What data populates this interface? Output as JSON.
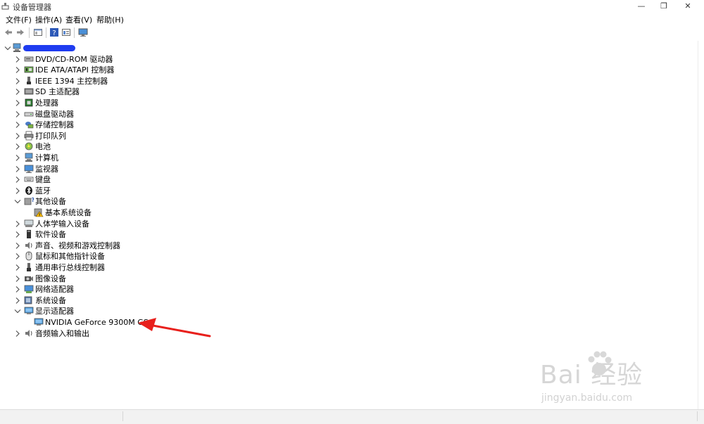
{
  "window": {
    "title": "设备管理器",
    "minimize_glyph": "—",
    "restore_glyph": "❐",
    "close_glyph": "✕"
  },
  "menu": [
    "文件(F)",
    "操作(A)",
    "查看(V)",
    "帮助(H)"
  ],
  "toolbar": [
    "back-icon",
    "forward-icon",
    "properties-icon",
    "help-icon",
    "details-icon",
    "monitor-icon"
  ],
  "tree": {
    "root": {
      "label": "",
      "icon": "computer-icon",
      "expanded": true
    },
    "items": [
      {
        "label": "DVD/CD-ROM 驱动器",
        "icon": "dvd-drive-icon",
        "expanded": false,
        "children": []
      },
      {
        "label": "IDE ATA/ATAPI 控制器",
        "icon": "ide-controller-icon",
        "expanded": false,
        "children": []
      },
      {
        "label": "IEEE 1394 主控制器",
        "icon": "ieee1394-icon",
        "expanded": false,
        "children": []
      },
      {
        "label": "SD 主适配器",
        "icon": "sd-adapter-icon",
        "expanded": false,
        "children": []
      },
      {
        "label": "处理器",
        "icon": "processor-icon",
        "expanded": false,
        "children": []
      },
      {
        "label": "磁盘驱动器",
        "icon": "disk-drive-icon",
        "expanded": false,
        "children": []
      },
      {
        "label": "存储控制器",
        "icon": "storage-controller-icon",
        "expanded": false,
        "children": []
      },
      {
        "label": "打印队列",
        "icon": "printer-icon",
        "expanded": false,
        "children": []
      },
      {
        "label": "电池",
        "icon": "battery-icon",
        "expanded": false,
        "children": []
      },
      {
        "label": "计算机",
        "icon": "computer-icon",
        "expanded": false,
        "children": []
      },
      {
        "label": "监视器",
        "icon": "monitor-icon",
        "expanded": false,
        "children": []
      },
      {
        "label": "键盘",
        "icon": "keyboard-icon",
        "expanded": false,
        "children": []
      },
      {
        "label": "蓝牙",
        "icon": "bluetooth-icon",
        "expanded": false,
        "children": []
      },
      {
        "label": "其他设备",
        "icon": "other-devices-icon",
        "expanded": true,
        "children": [
          {
            "label": "基本系统设备",
            "icon": "warning-device-icon"
          }
        ]
      },
      {
        "label": "人体学输入设备",
        "icon": "hid-icon",
        "expanded": false,
        "children": []
      },
      {
        "label": "软件设备",
        "icon": "software-device-icon",
        "expanded": false,
        "children": []
      },
      {
        "label": "声音、视频和游戏控制器",
        "icon": "sound-icon",
        "expanded": false,
        "children": []
      },
      {
        "label": "鼠标和其他指针设备",
        "icon": "mouse-icon",
        "expanded": false,
        "children": []
      },
      {
        "label": "通用串行总线控制器",
        "icon": "usb-icon",
        "expanded": false,
        "children": []
      },
      {
        "label": "图像设备",
        "icon": "camera-icon",
        "expanded": false,
        "children": []
      },
      {
        "label": "网络适配器",
        "icon": "network-adapter-icon",
        "expanded": false,
        "children": []
      },
      {
        "label": "系统设备",
        "icon": "system-device-icon",
        "expanded": false,
        "children": []
      },
      {
        "label": "显示适配器",
        "icon": "display-adapter-icon",
        "expanded": true,
        "children": [
          {
            "label": "NVIDIA GeForce 9300M GS",
            "icon": "display-adapter-icon"
          }
        ]
      },
      {
        "label": "音频输入和输出",
        "icon": "audio-io-icon",
        "expanded": false,
        "children": []
      }
    ]
  },
  "annotation": {
    "arrow_color": "#e8201c",
    "redaction_color": "#1f3cf0"
  },
  "watermark": {
    "brand": "Bai 经验",
    "url": "jingyan.baidu.com"
  }
}
